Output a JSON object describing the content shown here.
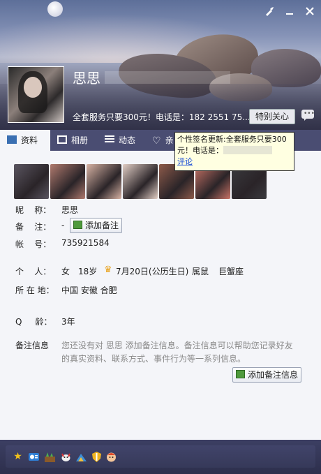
{
  "header": {
    "nickname": "思思",
    "signature": "全套服务只要300元！电话是：182 2551 75...",
    "care_button": "特别关心",
    "skin_icon": "brush-icon",
    "min_icon": "minimize-icon",
    "close_icon": "close-icon",
    "chat_icon": "chat-bubble-icon"
  },
  "tabs": [
    {
      "label": "资料",
      "icon": "profile-card-icon"
    },
    {
      "label": "相册",
      "icon": "photo-album-icon"
    },
    {
      "label": "动态",
      "icon": "feed-list-icon"
    },
    {
      "label": "亲",
      "icon": "heart-icon"
    }
  ],
  "tooltip": {
    "line1": "个性签名更新:全套服务只要300",
    "line2": "元！电话是：",
    "link": "评论"
  },
  "profile": {
    "nickname_label": "昵    称：",
    "nickname_value": "思思",
    "remark_label": "备    注：",
    "remark_value": "-",
    "add_remark_button": "添加备注",
    "account_label": "帐    号：",
    "account_value": "735921584",
    "personal_label": "个    人：",
    "gender": "女",
    "age": "18岁",
    "birthday": "7月20日(公历生日)",
    "zodiac": "属鼠",
    "constellation": "巨蟹座",
    "location_label": "所 在 地：",
    "location_value": "中国 安徽 合肥",
    "qage_label": "Q     龄：",
    "qage_value": "3年",
    "note_label": "备注信息",
    "note_text": "您还没有对 思思 添加备注信息。备注信息可以帮助您记录好友的真实资料、联系方式、事件行为等一系列信息。",
    "add_note_button": "添加备注信息"
  },
  "photos": [
    {
      "name": "photo-1",
      "color": "#5a5560"
    },
    {
      "name": "photo-2",
      "color": "#b07a6e"
    },
    {
      "name": "photo-3",
      "color": "#d8b3a4"
    },
    {
      "name": "photo-4",
      "color": "#e3cfc6"
    },
    {
      "name": "photo-5",
      "color": "#8d5a4a"
    },
    {
      "name": "photo-6",
      "color": "#c97366"
    },
    {
      "name": "photo-7",
      "color": "#3a3a3e"
    }
  ],
  "bottom_icons": [
    "star-icon",
    "qq-mail-icon",
    "farm-icon",
    "pet-icon",
    "ranch-icon",
    "shield-icon",
    "game-icon"
  ]
}
